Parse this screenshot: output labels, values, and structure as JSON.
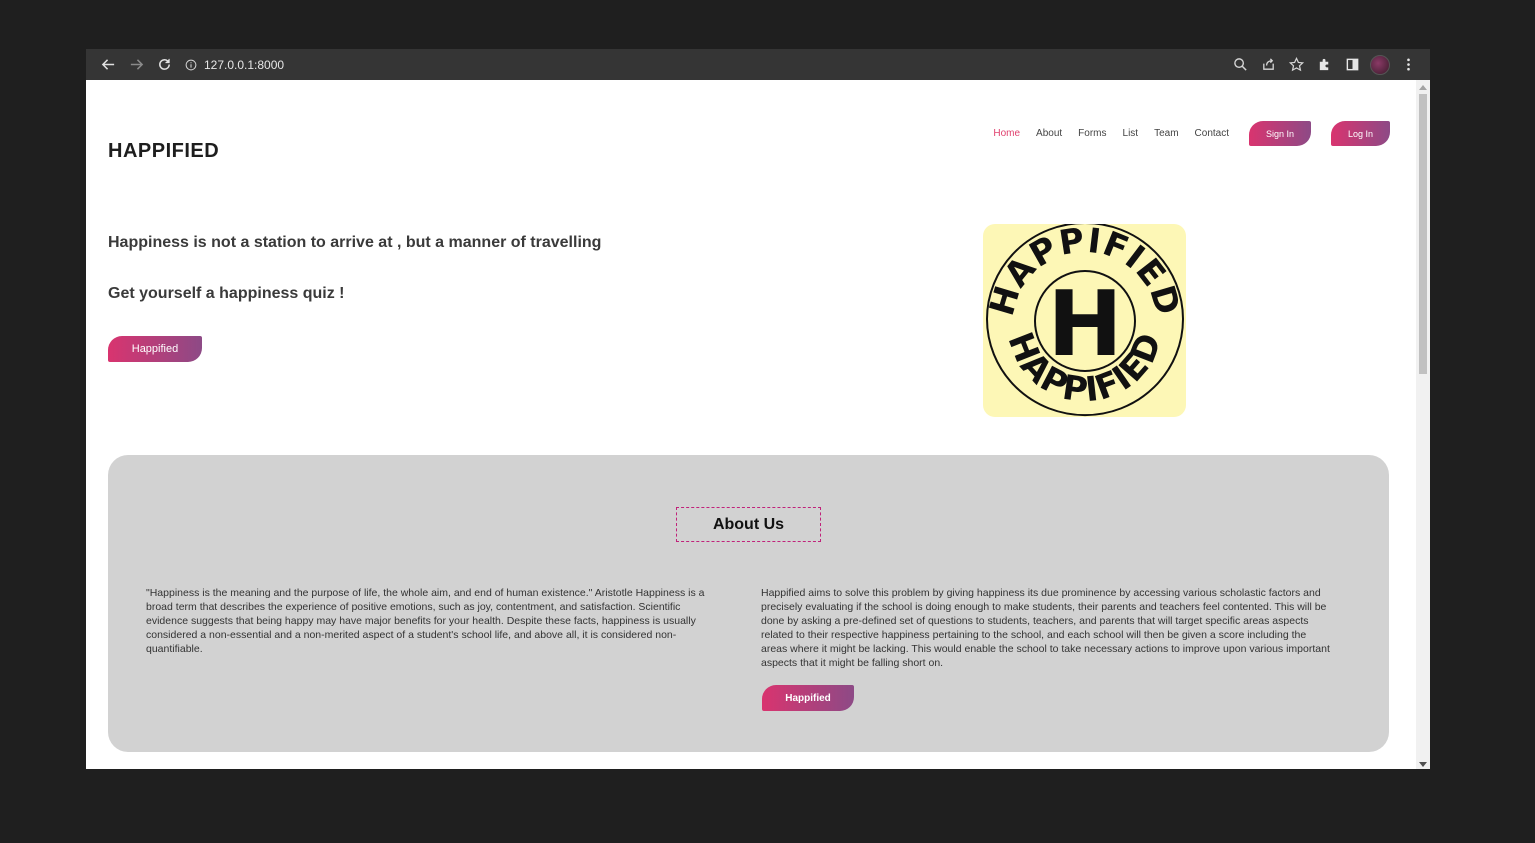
{
  "browser": {
    "url": "127.0.0.1:8000"
  },
  "header": {
    "brand": "HAPPIFIED",
    "nav": [
      {
        "label": "Home",
        "active": true
      },
      {
        "label": "About"
      },
      {
        "label": "Forms"
      },
      {
        "label": "List"
      },
      {
        "label": "Team"
      },
      {
        "label": "Contact"
      }
    ],
    "signin_label": "Sign In",
    "login_label": "Log In"
  },
  "hero": {
    "quote": "Happiness is not a station to arrive at , but a manner of travelling",
    "quiz": "Get yourself a happiness quiz !",
    "button_label": "Happified",
    "logo_text_top": "HAPPIFIED",
    "logo_text_bottom": "HAPPIFIED",
    "logo_letter": "H"
  },
  "about": {
    "title": "About Us",
    "left_text": "\"Happiness is the meaning and the purpose of life, the whole aim, and end of human existence.\" Aristotle Happiness is a broad term that describes the experience of positive emotions, such as joy, contentment, and satisfaction. Scientific evidence suggests that being happy may have major benefits for your health. Despite these facts, happiness is usually considered a non-essential and a non-merited aspect of a student's school life, and above all, it is considered non-quantifiable.",
    "right_text": "Happified aims to solve this problem by giving happiness its due prominence by accessing various scholastic factors and precisely evaluating if the school is doing enough to make students, their parents and teachers feel contented. This will be done by asking a pre-defined set of questions to students, teachers, and parents that will target specific areas aspects related to their respective happiness pertaining to the school, and each school will then be given a score including the areas where it might be lacking. This would enable the school to take necessary actions to improve upon various important aspects that it might be falling short on.",
    "button_label": "Happified"
  },
  "colors": {
    "accent_start": "#d9346f",
    "accent_end": "#8d4a86",
    "nav_active": "#e0416e",
    "logo_bg": "#fdf7b6",
    "section_bg": "#d2d2d2"
  }
}
